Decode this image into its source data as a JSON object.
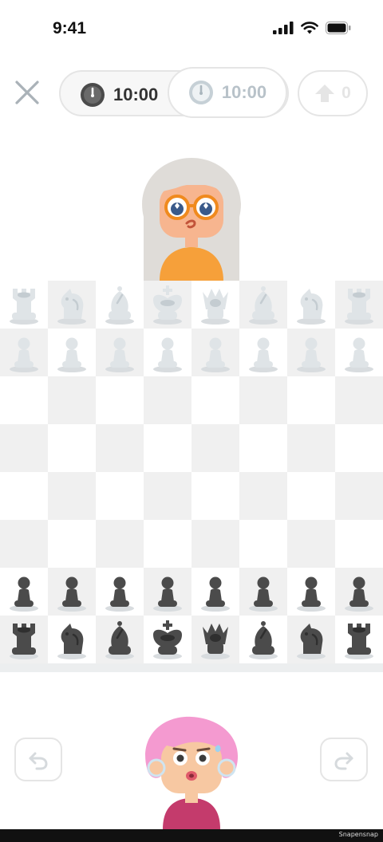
{
  "status_bar": {
    "time": "9:41"
  },
  "timers": {
    "self": {
      "value": "10:00",
      "icon": "clock-icon"
    },
    "opponent": {
      "value": "10:00",
      "icon": "clock-icon"
    }
  },
  "upload": {
    "count": "0",
    "icon": "arrow-up-icon"
  },
  "board": {
    "ranks": [
      [
        "wR",
        "wN",
        "wB",
        "wK",
        "wQ",
        "wB",
        "wN",
        "wR"
      ],
      [
        "wP",
        "wP",
        "wP",
        "wP",
        "wP",
        "wP",
        "wP",
        "wP"
      ],
      [
        "",
        "",
        "",
        "",
        "",
        "",
        "",
        ""
      ],
      [
        "",
        "",
        "",
        "",
        "",
        "",
        "",
        ""
      ],
      [
        "",
        "",
        "",
        "",
        "",
        "",
        "",
        ""
      ],
      [
        "",
        "",
        "",
        "",
        "",
        "",
        "",
        ""
      ],
      [
        "bP",
        "bP",
        "bP",
        "bP",
        "bP",
        "bP",
        "bP",
        "bP"
      ],
      [
        "bR",
        "bN",
        "bB",
        "bK",
        "bQ",
        "bB",
        "bN",
        "bR"
      ]
    ],
    "colors": {
      "light_square": "#ffffff",
      "dark_square": "#f0f0f0",
      "white_piece": "#dfe4e7",
      "black_piece": "#4b4b4b"
    }
  },
  "controls": {
    "undo_icon": "undo-icon",
    "redo_icon": "redo-icon"
  },
  "watermark": "Snapensnap"
}
